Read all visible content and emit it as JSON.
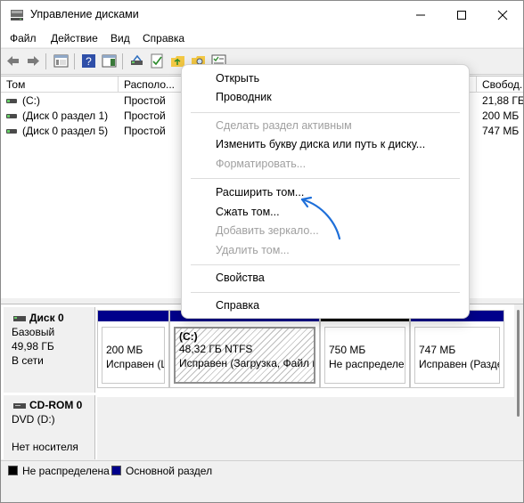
{
  "window": {
    "title": "Управление дисками"
  },
  "menubar": {
    "items": [
      "Файл",
      "Действие",
      "Вид",
      "Справка"
    ]
  },
  "columns": [
    "Том",
    "Располо...",
    "Свобод..."
  ],
  "volumes": [
    {
      "name": "(C:)",
      "layout": "Простой",
      "free": "21,88 ГБ"
    },
    {
      "name": "(Диск 0 раздел 1)",
      "layout": "Простой",
      "free": "200 МБ"
    },
    {
      "name": "(Диск 0 раздел 5)",
      "layout": "Простой",
      "free": "747 МБ"
    }
  ],
  "disk0": {
    "name": "Диск 0",
    "type": "Базовый",
    "size": "49,98 ГБ",
    "status": "В сети",
    "partitions": [
      {
        "title": "",
        "size": "200 МБ",
        "status": "Исправен (L"
      },
      {
        "title": "(C:)",
        "size": "48,32 ГБ NTFS",
        "status": "Исправен (Загрузка, Файл п"
      },
      {
        "title": "",
        "size": "750 МБ",
        "status": "Не распределен"
      },
      {
        "title": "",
        "size": "747 МБ",
        "status": "Исправен (Разде"
      }
    ]
  },
  "cdrom": {
    "name": "CD-ROM 0",
    "drive": "DVD (D:)",
    "status": "Нет носителя"
  },
  "legend": {
    "unallocated": "Не распределена",
    "primary": "Основной раздел"
  },
  "context_menu": {
    "open": "Открыть",
    "explorer": "Проводник",
    "mark_active": "Сделать раздел активным",
    "change_letter": "Изменить букву диска или путь к диску...",
    "format": "Форматировать...",
    "extend": "Расширить том...",
    "shrink": "Сжать том...",
    "add_mirror": "Добавить зеркало...",
    "delete": "Удалить том...",
    "properties": "Свойства",
    "help": "Справка"
  },
  "colors": {
    "primary": "#00008b",
    "unallocated": "#000000",
    "arrow": "#1e6fd9"
  }
}
